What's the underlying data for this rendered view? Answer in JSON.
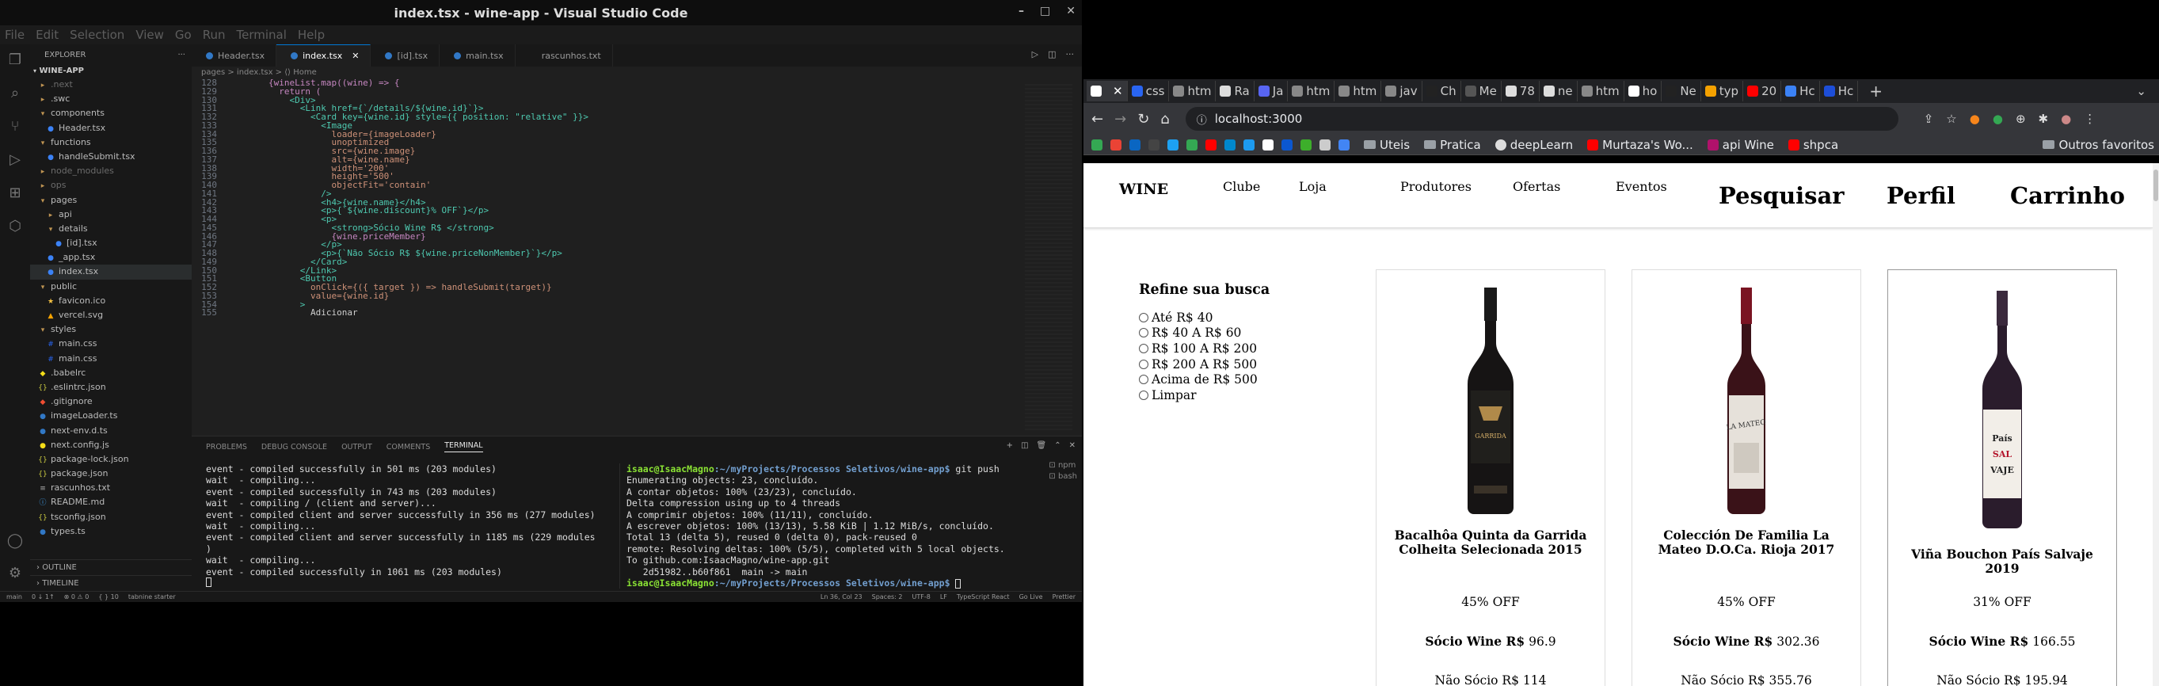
{
  "vscode": {
    "window_title": "index.tsx - wine-app - Visual Studio Code",
    "menu": [
      "File",
      "Edit",
      "Selection",
      "View",
      "Go",
      "Run",
      "Terminal",
      "Help"
    ],
    "explorer_title": "EXPLORER",
    "project": "WINE-APP",
    "tree": [
      {
        "label": ".next",
        "indent": 1,
        "kind": "folder"
      },
      {
        "label": ".swc",
        "indent": 1,
        "kind": "folder"
      },
      {
        "label": "components",
        "indent": 1,
        "kind": "folder-open"
      },
      {
        "label": "Header.tsx",
        "indent": 2,
        "kind": "tsx"
      },
      {
        "label": "functions",
        "indent": 1,
        "kind": "folder-open"
      },
      {
        "label": "handleSubmit.tsx",
        "indent": 2,
        "kind": "tsx"
      },
      {
        "label": "node_modules",
        "indent": 1,
        "kind": "folder"
      },
      {
        "label": "ops",
        "indent": 1,
        "kind": "folder"
      },
      {
        "label": "pages",
        "indent": 1,
        "kind": "folder-open"
      },
      {
        "label": "api",
        "indent": 2,
        "kind": "folder"
      },
      {
        "label": "details",
        "indent": 2,
        "kind": "folder-open"
      },
      {
        "label": "[id].tsx",
        "indent": 3,
        "kind": "tsx"
      },
      {
        "label": "_app.tsx",
        "indent": 2,
        "kind": "tsx"
      },
      {
        "label": "index.tsx",
        "indent": 2,
        "kind": "tsx",
        "selected": true
      },
      {
        "label": "public",
        "indent": 1,
        "kind": "folder-open"
      },
      {
        "label": "favicon.ico",
        "indent": 2,
        "kind": "ico"
      },
      {
        "label": "vercel.svg",
        "indent": 2,
        "kind": "svg"
      },
      {
        "label": "styles",
        "indent": 1,
        "kind": "folder-open"
      },
      {
        "label": "main.css",
        "indent": 2,
        "kind": "css"
      },
      {
        "label": "main.css",
        "indent": 2,
        "kind": "css"
      },
      {
        "label": ".babelrc",
        "indent": 1,
        "kind": "cfg"
      },
      {
        "label": ".eslintrc.json",
        "indent": 1,
        "kind": "json"
      },
      {
        "label": ".gitignore",
        "indent": 1,
        "kind": "git"
      },
      {
        "label": "imageLoader.ts",
        "indent": 1,
        "kind": "ts"
      },
      {
        "label": "next-env.d.ts",
        "indent": 1,
        "kind": "ts"
      },
      {
        "label": "next.config.js",
        "indent": 1,
        "kind": "js"
      },
      {
        "label": "package-lock.json",
        "indent": 1,
        "kind": "json"
      },
      {
        "label": "package.json",
        "indent": 1,
        "kind": "json"
      },
      {
        "label": "rascunhos.txt",
        "indent": 1,
        "kind": "txt"
      },
      {
        "label": "README.md",
        "indent": 1,
        "kind": "md"
      },
      {
        "label": "tsconfig.json",
        "indent": 1,
        "kind": "json"
      },
      {
        "label": "types.ts",
        "indent": 1,
        "kind": "ts"
      }
    ],
    "outline": "OUTLINE",
    "timeline": "TIMELINE",
    "tabs": [
      {
        "label": "Header.tsx",
        "active": false
      },
      {
        "label": "index.tsx",
        "active": true
      },
      {
        "label": "[id].tsx",
        "active": false
      },
      {
        "label": "main.tsx",
        "active": false
      },
      {
        "label": "rascunhos.txt",
        "active": false
      }
    ],
    "breadcrumb": "pages > index.tsx > ⟨⟩ Home",
    "code": [
      {
        "n": "128",
        "t": "        {wineList.map((wine) => {"
      },
      {
        "n": "129",
        "t": "          return ("
      },
      {
        "n": "130",
        "t": "            <Div>"
      },
      {
        "n": "131",
        "t": "              <Link href={`/details/${wine.id}`}>"
      },
      {
        "n": "132",
        "t": "                <Card key={wine.id} style={{ position: \"relative\" }}>"
      },
      {
        "n": "133",
        "t": "                  <Image"
      },
      {
        "n": "134",
        "t": "                    loader={imageLoader}"
      },
      {
        "n": "135",
        "t": "                    unoptimized"
      },
      {
        "n": "136",
        "t": "                    src={wine.image}"
      },
      {
        "n": "137",
        "t": "                    alt={wine.name}"
      },
      {
        "n": "138",
        "t": "                    width='200'"
      },
      {
        "n": "139",
        "t": "                    height='500'"
      },
      {
        "n": "140",
        "t": "                    objectFit='contain'"
      },
      {
        "n": "141",
        "t": "                  />"
      },
      {
        "n": "142",
        "t": "                  <h4>{wine.name}</h4>"
      },
      {
        "n": "143",
        "t": "                  <p>{`${wine.discount}% OFF`}</p>"
      },
      {
        "n": "144",
        "t": "                  <p>"
      },
      {
        "n": "145",
        "t": "                    <strong>Sócio Wine R$ </strong>"
      },
      {
        "n": "146",
        "t": "                    {wine.priceMember}"
      },
      {
        "n": "147",
        "t": "                  </p>"
      },
      {
        "n": "148",
        "t": "                  <p>{`Não Sócio R$ ${wine.priceNonMember}`}</p>"
      },
      {
        "n": "149",
        "t": "                </Card>"
      },
      {
        "n": "150",
        "t": "              </Link>"
      },
      {
        "n": "151",
        "t": "              <Button"
      },
      {
        "n": "152",
        "t": "                onClick={({ target }) => handleSubmit(target)}"
      },
      {
        "n": "153",
        "t": "                value={wine.id}"
      },
      {
        "n": "154",
        "t": "              >"
      },
      {
        "n": "155",
        "t": "                Adicionar"
      }
    ],
    "panel_tabs": [
      "PROBLEMS",
      "DEBUG CONSOLE",
      "OUTPUT",
      "COMMENTS",
      "TERMINAL"
    ],
    "terminal_left": [
      "event - compiled successfully in 501 ms (203 modules)",
      "wait  - compiling...",
      "event - compiled successfully in 743 ms (203 modules)",
      "wait  - compiling / (client and server)...",
      "event - compiled client and server successfully in 356 ms (277 modules)",
      "wait  - compiling...",
      "event - compiled client and server successfully in 1185 ms (229 modules",
      ")",
      "wait  - compiling...",
      "event - compiled successfully in 1061 ms (203 modules)"
    ],
    "terminal_right_prompt_user": "isaac@IsaacMagno",
    "terminal_right_prompt_path": ":~/myProjects/Processos Seletivos/wine-app$",
    "terminal_right_command": " git push",
    "terminal_right": [
      "Enumerating objects: 23, concluído.",
      "A contar objetos: 100% (23/23), concluído.",
      "Delta compression using up to 4 threads",
      "A comprimir objetos: 100% (11/11), concluído.",
      "A escrever objetos: 100% (13/13), 5.58 KiB | 1.12 MiB/s, concluído.",
      "Total 13 (delta 5), reused 0 (delta 0), pack-reused 0",
      "remote: Resolving deltas: 100% (5/5), completed with 5 local objects.",
      "To github.com:IsaacMagno/wine-app.git",
      "   2d51982..b60f861  main -> main"
    ],
    "terminal_list": [
      "npm",
      "bash"
    ],
    "status_left": [
      "main",
      "0 ↓ 1↑",
      "⊗ 0 ⚠ 0",
      "{ } 10",
      "tabnine starter"
    ],
    "status_right": [
      "Ln 36, Col 23",
      "Spaces: 2",
      "UTF-8",
      "LF",
      "TypeScript React",
      "Go Live",
      "Prettier"
    ]
  },
  "browser": {
    "tabs": [
      {
        "label": "",
        "color": "#ffffff",
        "active": true
      },
      {
        "label": "css",
        "color": "#2965f1"
      },
      {
        "label": "htm",
        "color": "#888888"
      },
      {
        "label": "Ra",
        "color": "#dddddd"
      },
      {
        "label": "Ja",
        "color": "#5865f2"
      },
      {
        "label": "htm",
        "color": "#888888"
      },
      {
        "label": "htm",
        "color": "#888888"
      },
      {
        "label": "jav",
        "color": "#888888"
      },
      {
        "label": "Ch",
        "color": "#222222"
      },
      {
        "label": "Me",
        "color": "#555555"
      },
      {
        "label": "78",
        "color": "#dddddd"
      },
      {
        "label": "ne",
        "color": "#dddddd"
      },
      {
        "label": "htm",
        "color": "#888888"
      },
      {
        "label": "ho",
        "color": "#ffffff"
      },
      {
        "label": "Ne",
        "color": "#222222"
      },
      {
        "label": "typ",
        "color": "#f4a100"
      },
      {
        "label": "20",
        "color": "#ff0000"
      },
      {
        "label": "Hc",
        "color": "#3b82f6"
      },
      {
        "label": "Hc",
        "color": "#1d4ed8"
      }
    ],
    "url": "localhost:3000",
    "bookmarks": [
      {
        "label": "",
        "color": "#34a853"
      },
      {
        "label": "",
        "color": "#ea4335"
      },
      {
        "label": "",
        "color": "#0a66c2"
      },
      {
        "label": "",
        "color": "#444444"
      },
      {
        "label": "",
        "color": "#1da1f2"
      },
      {
        "label": "",
        "color": "#34a853"
      },
      {
        "label": "",
        "color": "#ff0000"
      },
      {
        "label": "",
        "color": "#0088cc"
      },
      {
        "label": "",
        "color": "#1d9bf0"
      },
      {
        "label": "",
        "color": "#ffffff"
      },
      {
        "label": "",
        "color": "#0b57d0"
      },
      {
        "label": "",
        "color": "#3dae2b"
      },
      {
        "label": "",
        "color": "#cccccc"
      },
      {
        "label": "",
        "color": "#4285f4"
      }
    ],
    "bookmark_links": [
      {
        "label": "Uteis",
        "kind": "folder"
      },
      {
        "label": "Pratica",
        "kind": "folder"
      },
      {
        "label": "deepLearn",
        "kind": "wp"
      },
      {
        "label": "Murtaza's Wo...",
        "kind": "yt"
      },
      {
        "label": "api Wine",
        "kind": "w"
      },
      {
        "label": "shpca",
        "kind": "yt"
      }
    ],
    "other_bookmarks": "Outros favoritos"
  },
  "site": {
    "logo": "WINE",
    "nav": [
      "Clube",
      "Loja",
      "Produtores",
      "Ofertas",
      "Eventos"
    ],
    "nav_big": [
      "Pesquisar",
      "Perfil",
      "Carrinho"
    ],
    "filter_title": "Refine sua busca",
    "filters": [
      "Até R$ 40",
      "R$ 40 A R$ 60",
      "R$ 100 A R$ 200",
      "R$ 200 A R$ 500",
      "Acima de R$ 500",
      "Limpar"
    ],
    "products": [
      {
        "name": "Bacalhôa Quinta da Garrida Colheita Selecionada 2015",
        "discount": "45% OFF",
        "member_label": "Sócio Wine R$",
        "member_price": "96.9",
        "non_member": "Não Sócio R$ 114"
      },
      {
        "name": "Colección De Familia La Mateo D.O.Ca. Rioja 2017",
        "discount": "45% OFF",
        "member_label": "Sócio Wine R$",
        "member_price": "302.36",
        "non_member": "Não Sócio R$ 355.76"
      },
      {
        "name": "Viña Bouchon País Salvaje 2019",
        "discount": "31% OFF",
        "member_label": "Sócio Wine R$",
        "member_price": "166.55",
        "non_member": "Não Sócio R$ 195.94"
      }
    ]
  }
}
